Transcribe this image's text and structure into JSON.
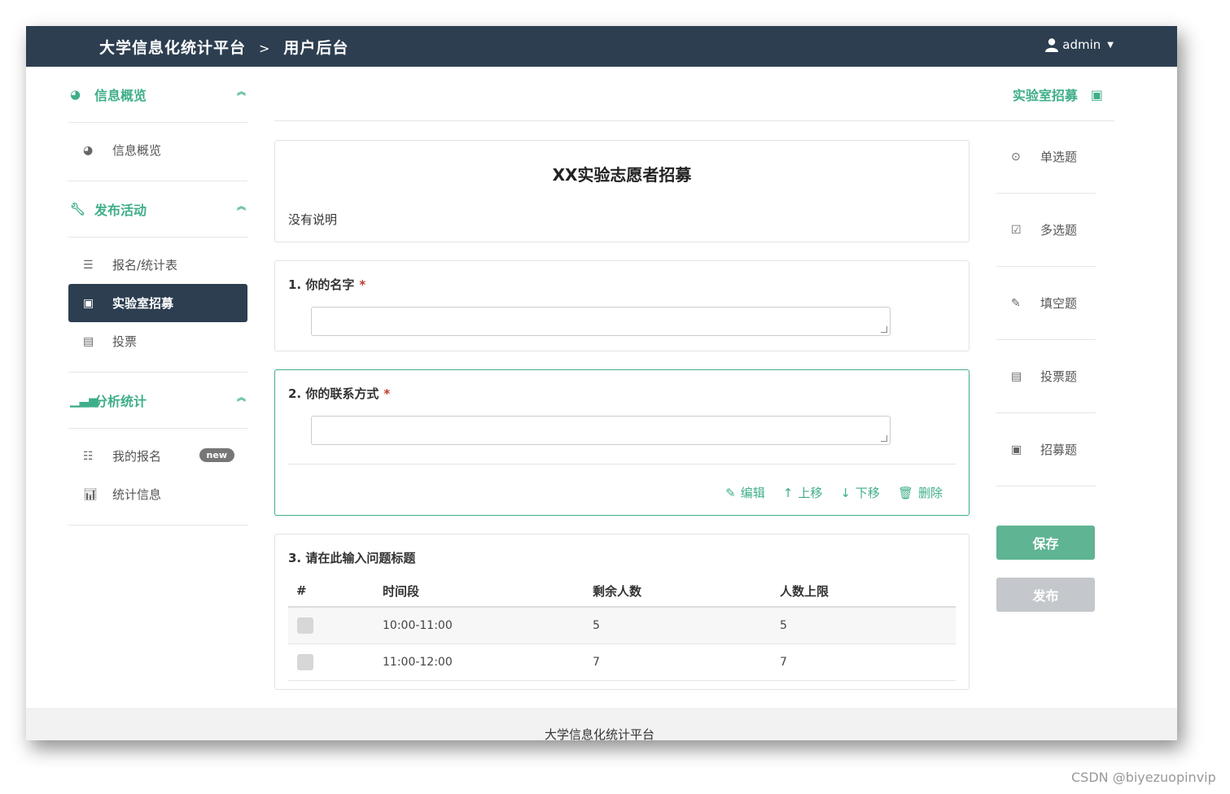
{
  "header": {
    "brand": "大学信息化统计平台",
    "separator": ">",
    "page": "用户后台",
    "user": "admin"
  },
  "sidebar": {
    "sections": [
      {
        "label": "信息概览",
        "items": [
          {
            "label": "信息概览"
          }
        ]
      },
      {
        "label": "发布活动",
        "items": [
          {
            "label": "报名/统计表"
          },
          {
            "label": "实验室招募"
          },
          {
            "label": "投票"
          }
        ]
      },
      {
        "label": "分析统计",
        "items": [
          {
            "label": "我的报名",
            "badge": "new"
          },
          {
            "label": "统计信息"
          }
        ]
      }
    ]
  },
  "main": {
    "title": "实验室招募",
    "form": {
      "title": "XX实验志愿者招募",
      "description": "没有说明"
    },
    "questions": [
      {
        "label": "1.  你的名字",
        "required": "*"
      },
      {
        "label": "2.  你的联系方式",
        "required": "*",
        "actions": [
          "编辑",
          "上移",
          "下移",
          "删除"
        ]
      },
      {
        "label": "3.  请在此输入问题标题",
        "table": {
          "headers": [
            "#",
            "时间段",
            "剩余人数",
            "人数上限"
          ],
          "rows": [
            [
              "",
              "10:00-11:00",
              "5",
              "5"
            ],
            [
              "",
              "11:00-12:00",
              "7",
              "7"
            ]
          ]
        }
      }
    ]
  },
  "right_panel": {
    "items": [
      "单选题",
      "多选题",
      "填空题",
      "投票题",
      "招募题"
    ],
    "save": "保存",
    "publish": "发布"
  },
  "footer": "大学信息化统计平台",
  "watermark": "CSDN @biyezuopinvip"
}
